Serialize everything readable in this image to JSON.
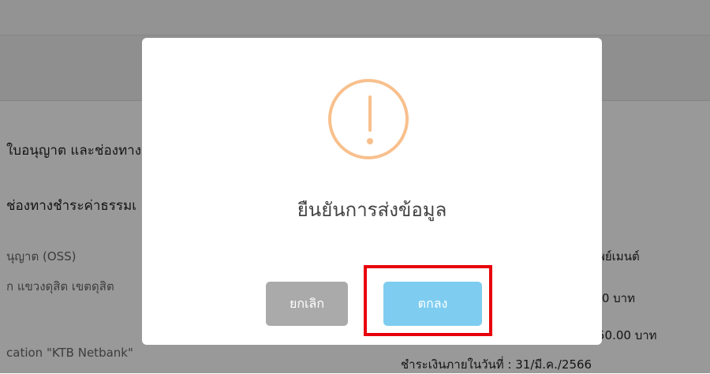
{
  "background": {
    "line1": "ใบอนุญาต และช่องทาง",
    "line2": "ช่องทางชำระค่าธรรมเ",
    "line3": "นุญาต (OSS)",
    "line4": "ก แขวงดุสิต เขตดุสิต",
    "line5": "cation \"KTB Netbank\"",
    "right1": "พย์เมนต์",
    "right2": ")0 บาท",
    "right3": "50.00 บาท",
    "right4": "ชำระเงินภายในวันที่ : 31/มี.ค./2566"
  },
  "dialog": {
    "icon": "exclamation-circle-icon",
    "title": "ยืนยันการส่งข้อมูล",
    "cancel_label": "ยกเลิก",
    "ok_label": "ตกลง"
  },
  "colors": {
    "icon": "#f8c08d",
    "ok_button": "#7ecdf0",
    "cancel_button": "#aaaaaa",
    "highlight": "#e8000b"
  }
}
